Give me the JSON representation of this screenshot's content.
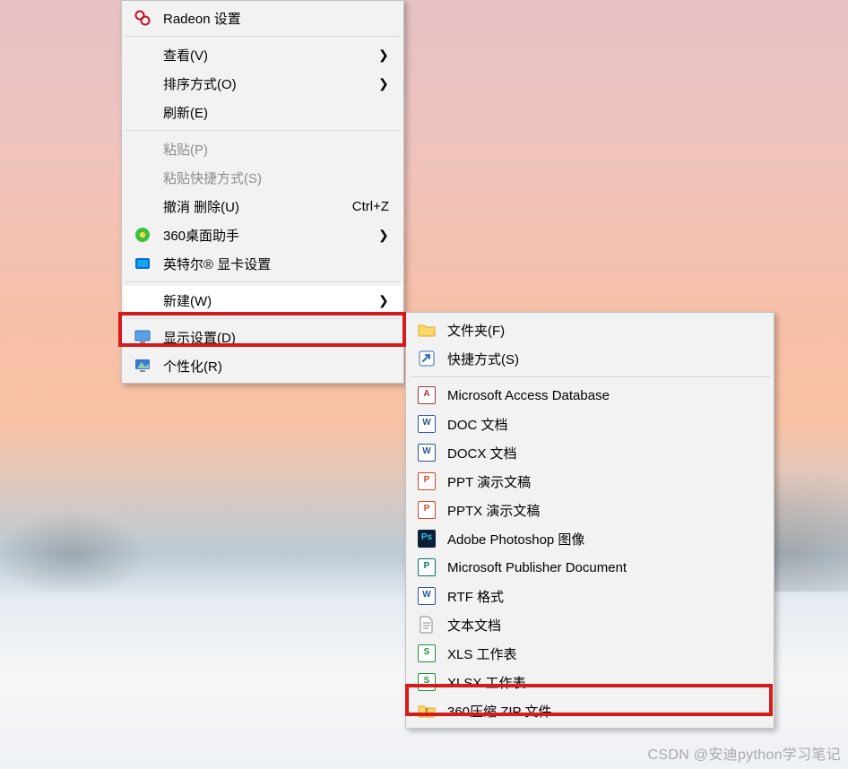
{
  "contextMenu": {
    "radeon": "Radeon 设置",
    "view": "查看(V)",
    "sort": "排序方式(O)",
    "refresh": "刷新(E)",
    "paste": "粘贴(P)",
    "pasteShortcut": "粘贴快捷方式(S)",
    "undoDelete": "撤消 删除(U)",
    "undoDeleteAccel": "Ctrl+Z",
    "deskHelper": "360桌面助手",
    "intelGfx": "英特尔® 显卡设置",
    "new": "新建(W)",
    "display": "显示设置(D)",
    "personalize": "个性化(R)"
  },
  "newSubmenu": {
    "folder": "文件夹(F)",
    "shortcut": "快捷方式(S)",
    "access": "Microsoft Access Database",
    "doc": "DOC 文档",
    "docx": "DOCX 文档",
    "ppt": "PPT 演示文稿",
    "pptx": "PPTX 演示文稿",
    "psd": "Adobe Photoshop 图像",
    "publisher": "Microsoft Publisher Document",
    "rtf": "RTF 格式",
    "txt": "文本文档",
    "xls": "XLS 工作表",
    "xlsx": "XLSX 工作表",
    "zip": "360压缩 ZIP 文件"
  },
  "watermark": "CSDN @安迪python学习笔记",
  "icons": {
    "chevron": "❯"
  }
}
